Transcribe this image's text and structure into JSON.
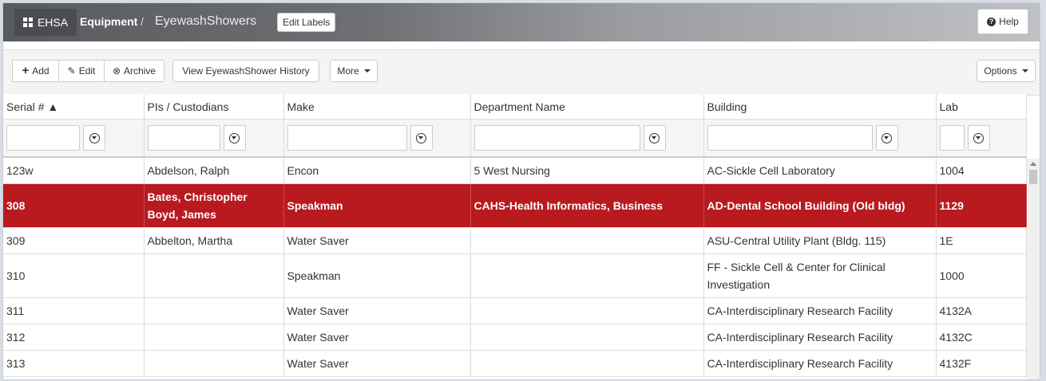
{
  "header": {
    "brand": "EHSA",
    "breadcrumb_section": "Equipment",
    "breadcrumb_sep": "/",
    "breadcrumb_page": "EyewashShowers",
    "edit_labels": "Edit Labels",
    "help": "Help"
  },
  "toolbar": {
    "add": "Add",
    "edit": "Edit",
    "archive": "Archive",
    "history": "View EyewashShower History",
    "more": "More",
    "options": "Options"
  },
  "table": {
    "columns": [
      "Serial # ▲",
      "PIs / Custodians",
      "Make",
      "Department Name",
      "Building",
      "Lab"
    ],
    "rows": [
      [
        "123w",
        "Abdelson, Ralph",
        "Encon",
        "5 West Nursing",
        "AC-Sickle Cell Laboratory",
        "1004"
      ],
      [
        "308",
        "Bates, Christopher\nBoyd, James",
        "Speakman",
        "CAHS-Health Informatics, Business",
        "AD-Dental School Building (Old bldg)",
        "1129"
      ],
      [
        "309",
        "Abbelton, Martha",
        "Water Saver",
        "",
        "ASU-Central Utility Plant (Bldg. 115)",
        "1E"
      ],
      [
        "310",
        "",
        "Speakman",
        "",
        "FF - Sickle Cell & Center for Clinical Investigation",
        "1000"
      ],
      [
        "311",
        "",
        "Water Saver",
        "",
        "CA-Interdisciplinary Research Facility",
        "4132A"
      ],
      [
        "312",
        "",
        "Water Saver",
        "",
        "CA-Interdisciplinary Research Facility",
        "4132C"
      ],
      [
        "313",
        "",
        "Water Saver",
        "",
        "CA-Interdisciplinary Research Facility",
        "4132F"
      ]
    ],
    "selected_serial": "308"
  },
  "colors": {
    "selected_row": "#b81a1f"
  }
}
